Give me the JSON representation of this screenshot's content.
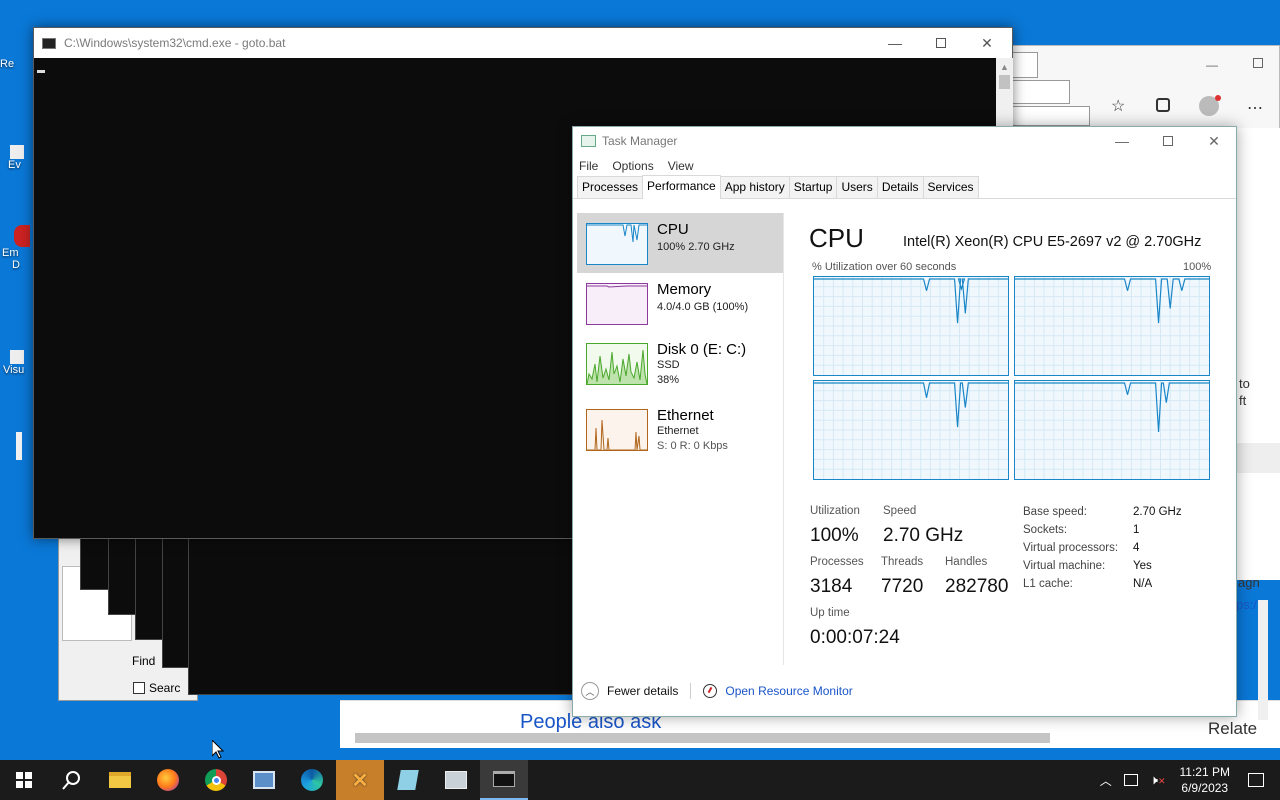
{
  "desktop": {
    "icons": [
      "Re",
      "Ev",
      "Em",
      "D",
      "Visu"
    ]
  },
  "cmd": {
    "title": "C:\\Windows\\system32\\cmd.exe - goto.bat"
  },
  "find_dialog": {
    "find_label": "Find",
    "search_label": "Searc"
  },
  "edge": {
    "side_text_1": "to",
    "side_text_2": "ft",
    "side_text_3": "agn",
    "side_text_4": "ps:/",
    "people_also_ask": "People also ask",
    "related": "Relate"
  },
  "task_manager": {
    "title": "Task Manager",
    "menu": [
      "File",
      "Options",
      "View"
    ],
    "tabs": [
      "Processes",
      "Performance",
      "App history",
      "Startup",
      "Users",
      "Details",
      "Services"
    ],
    "active_tab": "Performance",
    "sidebar": [
      {
        "name": "CPU",
        "line1": "100%  2.70 GHz",
        "line2": ""
      },
      {
        "name": "Memory",
        "line1": "4.0/4.0 GB (100%)",
        "line2": ""
      },
      {
        "name": "Disk 0 (E: C:)",
        "line1": "SSD",
        "line2": "38%"
      },
      {
        "name": "Ethernet",
        "line1": "Ethernet",
        "line2": "S: 0  R: 0 Kbps"
      }
    ],
    "cpu": {
      "heading": "CPU",
      "model": "Intel(R) Xeon(R) CPU E5-2697 v2 @ 2.70GHz",
      "graph_label": "% Utilization over 60 seconds",
      "graph_max": "100%",
      "utilization_label": "Utilization",
      "utilization": "100%",
      "speed_label": "Speed",
      "speed": "2.70 GHz",
      "processes_label": "Processes",
      "processes": "3184",
      "threads_label": "Threads",
      "threads": "7720",
      "handles_label": "Handles",
      "handles": "282780",
      "uptime_label": "Up time",
      "uptime": "0:00:07:24",
      "details": [
        {
          "k": "Base speed:",
          "v": "2.70 GHz"
        },
        {
          "k": "Sockets:",
          "v": "1"
        },
        {
          "k": "Virtual processors:",
          "v": "4"
        },
        {
          "k": "Virtual machine:",
          "v": "Yes"
        },
        {
          "k": "L1 cache:",
          "v": "N/A"
        }
      ]
    },
    "footer": {
      "fewer_details": "Fewer details",
      "resource_monitor": "Open Resource Monitor"
    }
  },
  "taskbar": {
    "time": "11:21 PM",
    "date": "6/9/2023",
    "apps": [
      "start-button",
      "search-icon",
      "file-explorer-icon",
      "firefox-icon",
      "chrome-icon",
      "app-icon",
      "edge-icon",
      "xampp-icon",
      "notepad-icon",
      "app2-icon",
      "cmd-icon"
    ]
  },
  "colors": {
    "desktop": "#0a78d7",
    "cpu_line": "#1a86c8",
    "memory_line": "#8b3a9b",
    "disk_line": "#4aa82c",
    "ethernet_line": "#b0651a"
  }
}
